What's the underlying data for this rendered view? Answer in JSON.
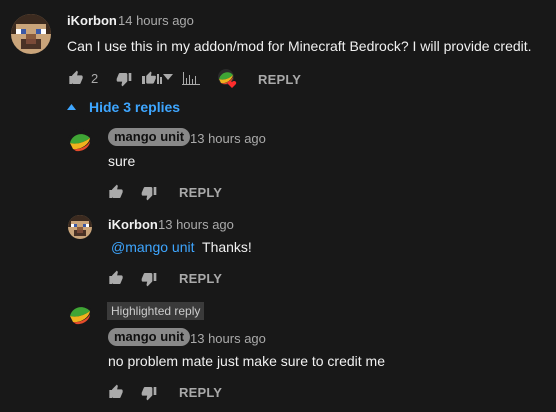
{
  "colors": {
    "background": "#181818",
    "link": "#3ea6ff",
    "pill": "#888888",
    "muted": "#aaaaaa"
  },
  "comment": {
    "author": "iKorbon",
    "time": "14 hours ago",
    "text": "Can I use this in my addon/mod for Minecraft Bedrock? I will provide credit.",
    "like_count": "2",
    "reply_label": "REPLY",
    "icons": [
      "thumbs-up-icon",
      "thumbs-down-icon",
      "sort-icon",
      "chevron-down-icon",
      "chart-icon",
      "creator-heart-icon"
    ]
  },
  "toggle": {
    "label": "Hide 3 replies"
  },
  "replies": [
    {
      "author": "mango unit",
      "time": "13 hours ago",
      "text": "sure",
      "reply_label": "REPLY"
    },
    {
      "author": "iKorbon",
      "time": "13 hours ago",
      "mention": "@mango unit",
      "text": "Thanks!",
      "reply_label": "REPLY"
    },
    {
      "badge": "Highlighted reply",
      "author": "mango unit",
      "time": "13 hours ago",
      "text": "no problem mate just make sure to credit me",
      "reply_label": "REPLY"
    }
  ]
}
